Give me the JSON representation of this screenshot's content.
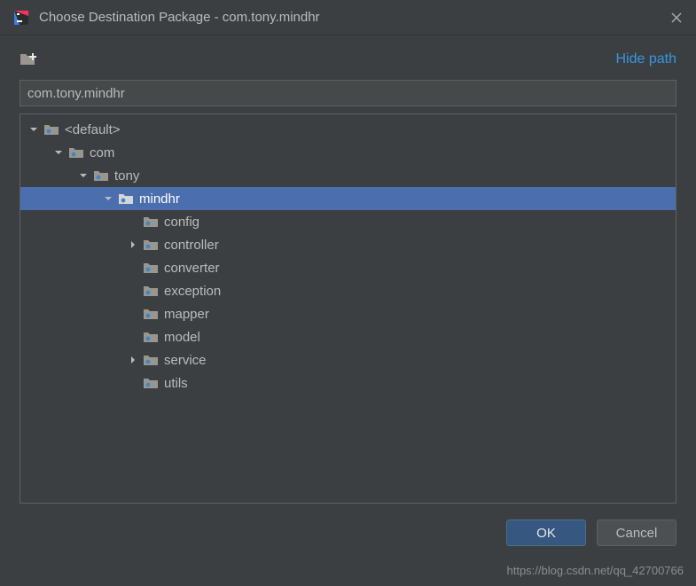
{
  "window": {
    "title": "Choose Destination Package - com.tony.mindhr"
  },
  "toolbar": {
    "hide_path_label": "Hide path"
  },
  "input": {
    "value": "com.tony.mindhr"
  },
  "tree": [
    {
      "depth": 0,
      "chevron": "down",
      "label": "<default>"
    },
    {
      "depth": 1,
      "chevron": "down",
      "label": "com"
    },
    {
      "depth": 2,
      "chevron": "down",
      "label": "tony"
    },
    {
      "depth": 3,
      "chevron": "down",
      "label": "mindhr",
      "selected": true
    },
    {
      "depth": 4,
      "chevron": "none",
      "label": "config"
    },
    {
      "depth": 4,
      "chevron": "right",
      "label": "controller"
    },
    {
      "depth": 4,
      "chevron": "none",
      "label": "converter"
    },
    {
      "depth": 4,
      "chevron": "none",
      "label": "exception"
    },
    {
      "depth": 4,
      "chevron": "none",
      "label": "mapper"
    },
    {
      "depth": 4,
      "chevron": "none",
      "label": "model"
    },
    {
      "depth": 4,
      "chevron": "right",
      "label": "service"
    },
    {
      "depth": 4,
      "chevron": "none",
      "label": "utils"
    }
  ],
  "buttons": {
    "ok": "OK",
    "cancel": "Cancel"
  },
  "watermark": "https://blog.csdn.net/qq_42700766"
}
